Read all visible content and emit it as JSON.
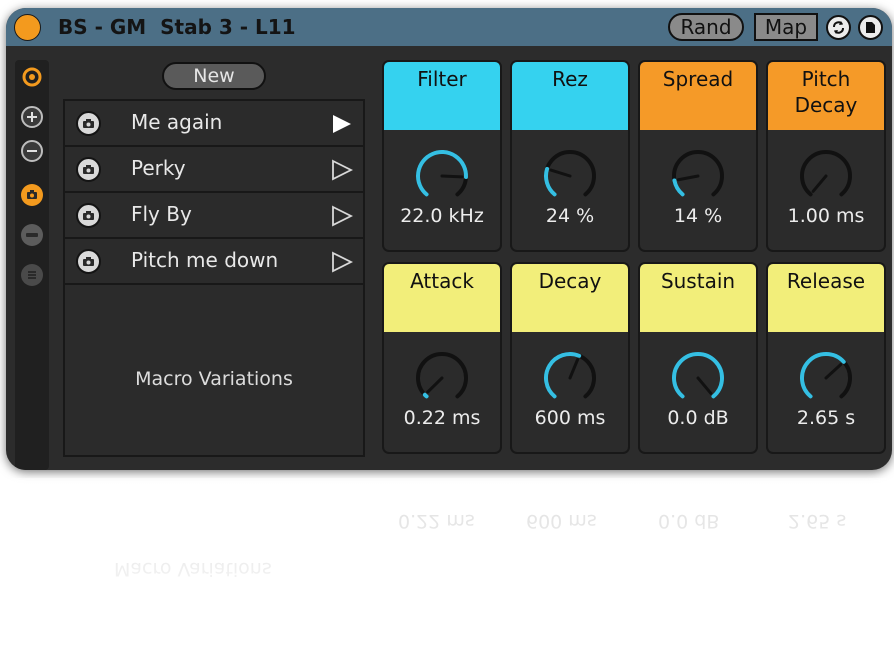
{
  "window": {
    "title": "BS - GM  Stab 3 - L11"
  },
  "header": {
    "rand_label": "Rand",
    "map_label": "Map",
    "icons": [
      "refresh-icon",
      "save-icon"
    ]
  },
  "sidebar": {
    "icons": [
      "ableton-logo-icon",
      "plus-icon",
      "minus-icon",
      "camera-icon",
      "collapse-icon",
      "list-icon"
    ]
  },
  "variations": {
    "new_label": "New",
    "items": [
      {
        "label": "Me again",
        "active": true
      },
      {
        "label": "Perky",
        "active": false
      },
      {
        "label": "Fly By",
        "active": false
      },
      {
        "label": "Pitch me down",
        "active": false
      }
    ],
    "panel_label": "Macro Variations"
  },
  "macros": [
    {
      "name": "Filter",
      "value": "22.0 kHz",
      "color": "#35d2ef",
      "level": 0.83
    },
    {
      "name": "Rez",
      "value": "24 %",
      "color": "#35d2ef",
      "level": 0.24
    },
    {
      "name": "Spread",
      "value": "14 %",
      "color": "#f59a28",
      "level": 0.14
    },
    {
      "name": "Pitch\nDecay",
      "value": "1.00 ms",
      "color": "#f59a28",
      "level": 0.0
    },
    {
      "name": "Attack",
      "value": "0.22 ms",
      "color": "#f2ee7a",
      "level": 0.02
    },
    {
      "name": "Decay",
      "value": "600 ms",
      "color": "#f2ee7a",
      "level": 0.58
    },
    {
      "name": "Sustain",
      "value": "0.0 dB",
      "color": "#f2ee7a",
      "level": 1.0
    },
    {
      "name": "Release",
      "value": "2.65 s",
      "color": "#f2ee7a",
      "level": 0.67
    }
  ],
  "colors": {
    "device_bg": "#2c2c2c",
    "titlebar": "#4c6f86",
    "accent": "#f39a1e",
    "arc": "#35bfe3"
  }
}
